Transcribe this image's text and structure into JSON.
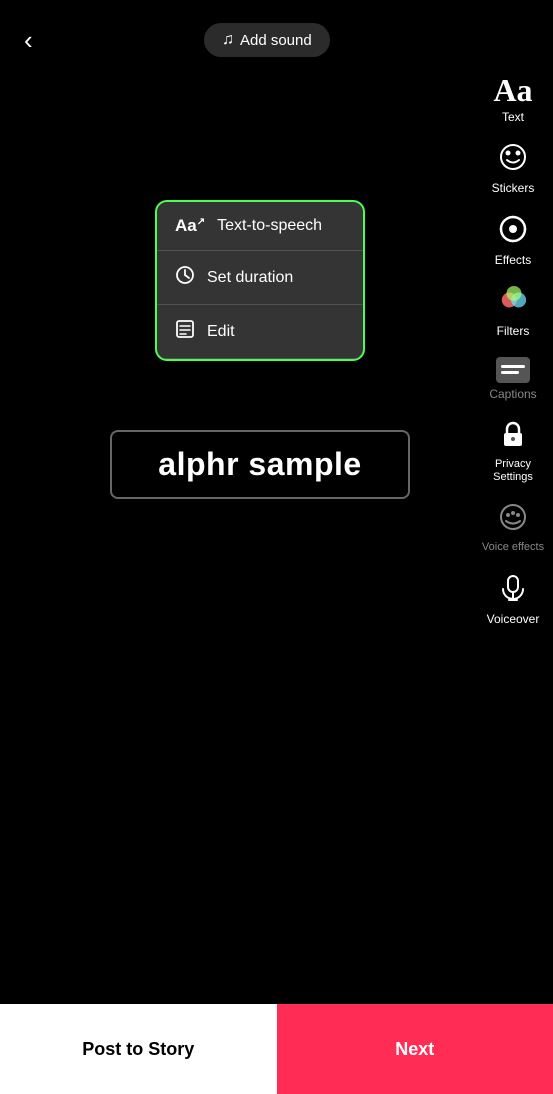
{
  "header": {
    "back_label": "‹",
    "add_sound_label": "Add sound",
    "music_icon": "♫"
  },
  "sidebar": {
    "items": [
      {
        "id": "text",
        "label": "Text",
        "icon_type": "text"
      },
      {
        "id": "stickers",
        "label": "Stickers",
        "icon_type": "sticker"
      },
      {
        "id": "effects",
        "label": "Effects",
        "icon_type": "effects"
      },
      {
        "id": "filters",
        "label": "Filters",
        "icon_type": "filters"
      },
      {
        "id": "captions",
        "label": "Captions",
        "icon_type": "captions",
        "dimmed": true
      },
      {
        "id": "privacy-settings",
        "label": "Privacy Settings",
        "icon_type": "lock"
      },
      {
        "id": "voice-effects",
        "label": "Voice effects",
        "icon_type": "voice",
        "dimmed": true
      },
      {
        "id": "voiceover",
        "label": "Voiceover",
        "icon_type": "mic"
      }
    ]
  },
  "popup_menu": {
    "items": [
      {
        "id": "text-to-speech",
        "label": "Text-to-speech",
        "icon": "Aa↗"
      },
      {
        "id": "set-duration",
        "label": "Set duration",
        "icon": "⏱"
      },
      {
        "id": "edit",
        "label": "Edit",
        "icon": "✎"
      }
    ]
  },
  "text_box": {
    "content": "alphr sample"
  },
  "bottom_bar": {
    "post_to_story_label": "Post to Story",
    "next_label": "Next"
  }
}
